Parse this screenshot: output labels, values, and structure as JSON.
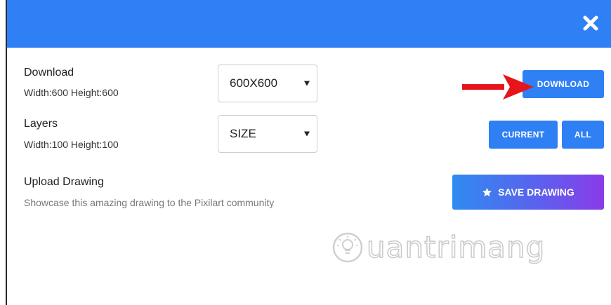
{
  "dialog": {
    "close_icon": "close-x-icon",
    "header_color": "#2f80f5"
  },
  "download": {
    "title": "Download",
    "subtitle": "Width:600 Height:600",
    "select_value": "600X600",
    "button_label": "DOWNLOAD"
  },
  "layers": {
    "title": "Layers",
    "subtitle": "Width:100 Height:100",
    "select_value": "SIZE",
    "current_label": "CURRENT",
    "all_label": "ALL"
  },
  "upload": {
    "title": "Upload Drawing",
    "subtitle": "Showcase this amazing drawing to the Pixilart community",
    "button_label": "SAVE DRAWING",
    "button_icon": "star-icon"
  },
  "watermark": {
    "text": "uantrimang"
  },
  "colors": {
    "accent": "#2f80f5",
    "annotation_arrow": "#e8141b"
  }
}
